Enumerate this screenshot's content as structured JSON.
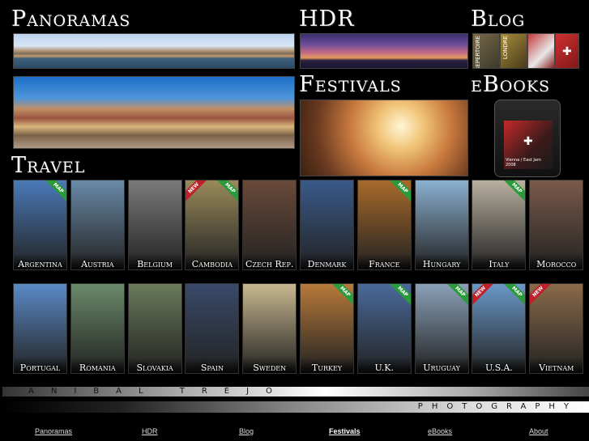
{
  "sections": {
    "panoramas": "Panoramas",
    "hdr": "HDR",
    "blog": "Blog",
    "festivals": "Festivals",
    "ebooks": "eBooks",
    "travel": "Travel"
  },
  "blog_strips": [
    "REPERTOIRE",
    "LONDRE"
  ],
  "ebook_cover_text": "Vienna / East Jam 2008",
  "travel": {
    "row1": [
      {
        "label": "Argentina",
        "ribbon": "MAP",
        "color": "#4a7ab8"
      },
      {
        "label": "Austria",
        "ribbon": "",
        "color": "#6a8aa8"
      },
      {
        "label": "Belgium",
        "ribbon": "",
        "color": "#7a7a7a"
      },
      {
        "label": "Cambodia",
        "ribbon": "NEW MAP",
        "color": "#9a8a5a"
      },
      {
        "label": "Czech Rep.",
        "ribbon": "",
        "color": "#6a4a3a"
      },
      {
        "label": "Denmark",
        "ribbon": "",
        "color": "#3a5a8a"
      },
      {
        "label": "France",
        "ribbon": "MAP",
        "color": "#a86a2a"
      },
      {
        "label": "Hungary",
        "ribbon": "",
        "color": "#8ab0d0"
      },
      {
        "label": "Italy",
        "ribbon": "MAP",
        "color": "#b8b0a0"
      },
      {
        "label": "Morocco",
        "ribbon": "",
        "color": "#7a5a4a"
      }
    ],
    "row2": [
      {
        "label": "Portugal",
        "ribbon": "",
        "color": "#5a8ac8"
      },
      {
        "label": "Romania",
        "ribbon": "",
        "color": "#6a8a6a"
      },
      {
        "label": "Slovakia",
        "ribbon": "",
        "color": "#6a7a5a"
      },
      {
        "label": "Spain",
        "ribbon": "",
        "color": "#3a4a6a"
      },
      {
        "label": "Sweden",
        "ribbon": "",
        "color": "#c8b890"
      },
      {
        "label": "Turkey",
        "ribbon": "MAP",
        "color": "#b87a3a"
      },
      {
        "label": "U.K.",
        "ribbon": "MAP",
        "color": "#4a6a9a"
      },
      {
        "label": "Uruguay",
        "ribbon": "MAP",
        "color": "#8aa0b8"
      },
      {
        "label": "U.S.A.",
        "ribbon": "NEW MAP",
        "color": "#6a98c8"
      },
      {
        "label": "Vietnam",
        "ribbon": "NEW",
        "color": "#8a6a4a"
      }
    ]
  },
  "brand": {
    "name": "ANIBAL TREJO",
    "tagline": "PHOTOGRAPHY"
  },
  "nav": [
    {
      "label": "Panoramas",
      "active": false
    },
    {
      "label": "HDR",
      "active": false
    },
    {
      "label": "Blog",
      "active": false
    },
    {
      "label": "Festivals",
      "active": true
    },
    {
      "label": "eBooks",
      "active": false
    },
    {
      "label": "About",
      "active": false
    }
  ]
}
